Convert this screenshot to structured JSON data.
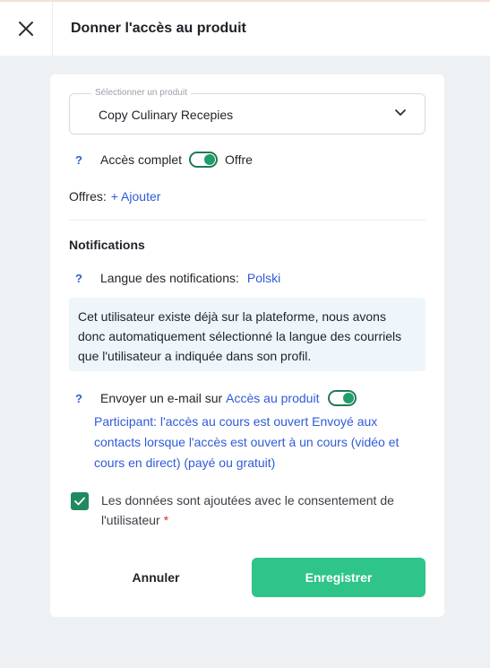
{
  "header": {
    "title": "Donner l'accès au produit",
    "close_icon": "close-icon"
  },
  "product_select": {
    "legend": "Sélectionner un produit",
    "value": "Copy Culinary Recepies",
    "icon": "chevron-down-icon"
  },
  "access": {
    "help": "?",
    "label": "Accès complet",
    "toggle_on": true,
    "toggle_label": "Offre"
  },
  "offers": {
    "label": "Offres:",
    "add_link": "+ Ajouter"
  },
  "notifications": {
    "title": "Notifications",
    "language_help": "?",
    "language_label": "Langue des notifications:",
    "language_value": "Polski",
    "info_text": "Cet utilisateur existe déjà sur la plateforme, nous avons donc automatiquement sélectionné la langue des courriels que l'utilisateur a indiquée dans son profil.",
    "email_help": "?",
    "email_label": "Envoyer un e-mail sur",
    "email_link": "Accès au produit",
    "email_toggle_on": true,
    "email_description": "Participant: l'accès au cours est ouvert Envoyé aux contacts lorsque l'accès est ouvert à un cours (vidéo et cours en direct) (payé ou gratuit)"
  },
  "consent": {
    "checked": true,
    "text": "Les données sont ajoutées avec le consentement de l'utilisateur",
    "required_mark": "*"
  },
  "actions": {
    "cancel_label": "Annuler",
    "save_label": "Enregistrer"
  },
  "colors": {
    "accent": "#2ec48a",
    "link": "#2f5bd8",
    "toggle": "#1f9d6b",
    "info_bg": "#eef6fb"
  }
}
